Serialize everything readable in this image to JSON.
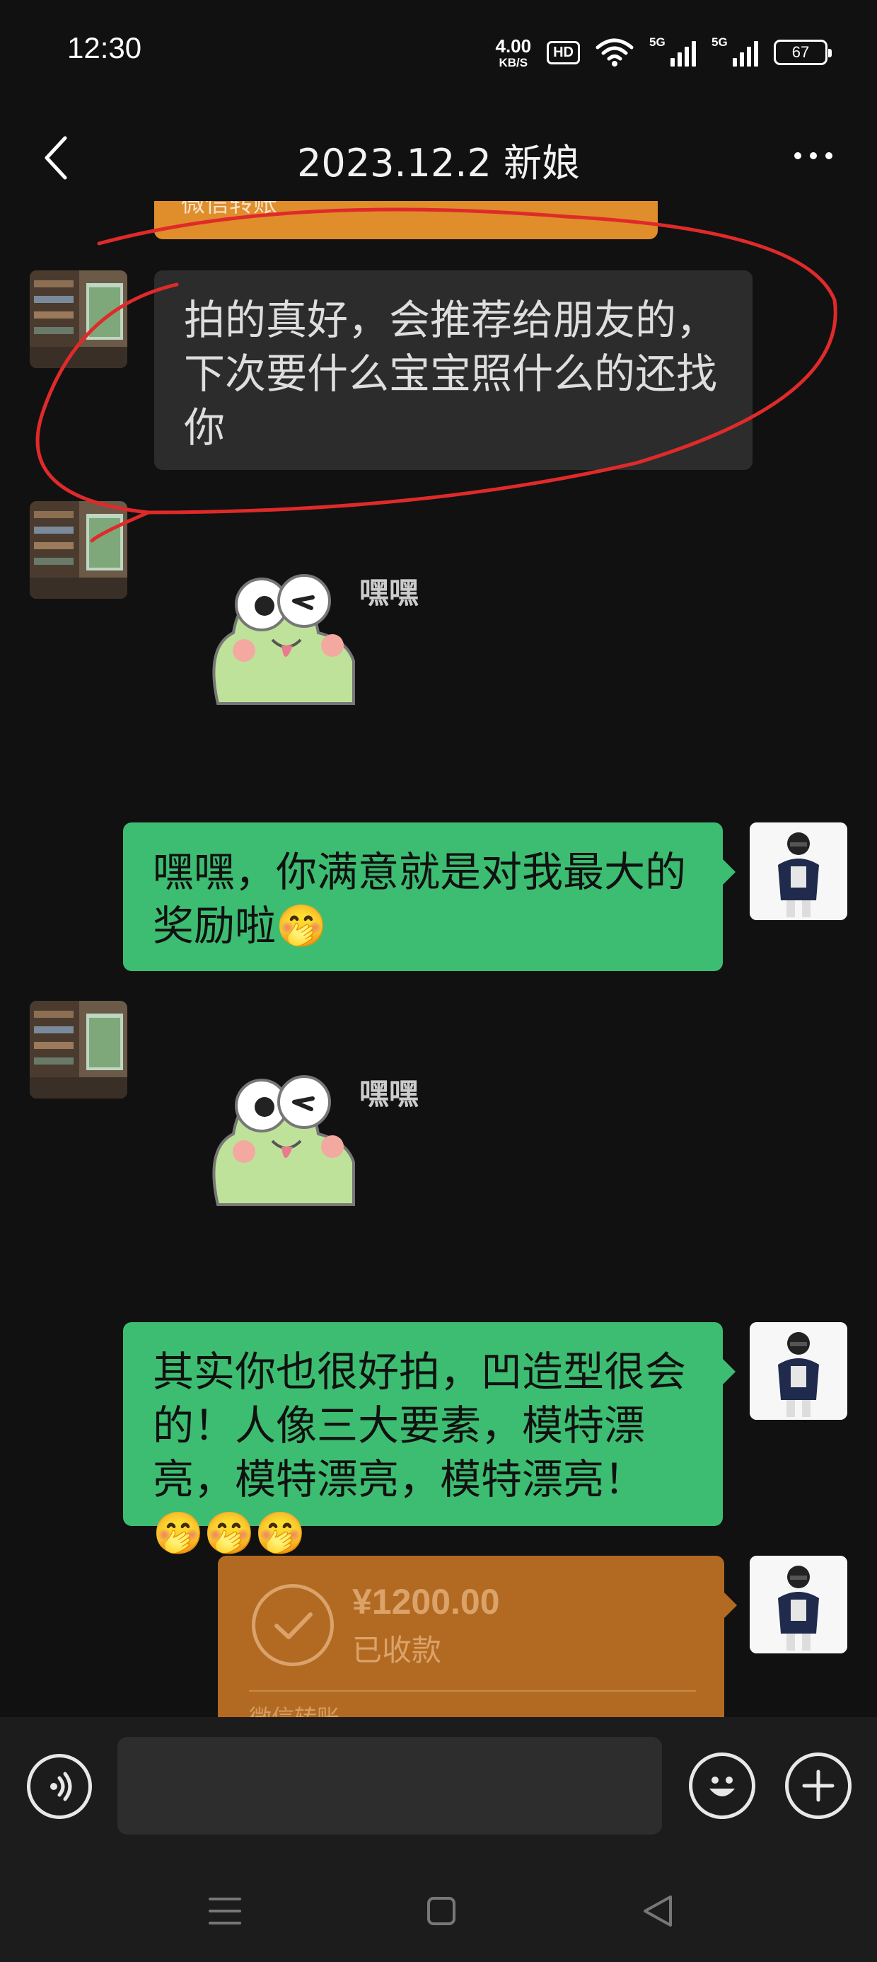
{
  "status_bar": {
    "time": "12:30",
    "net_speed_value": "4.00",
    "net_speed_unit": "KB/S",
    "hd_label": "HD",
    "signal1_label": "5G",
    "signal2_label": "5G",
    "battery_level": "67"
  },
  "header": {
    "title": "2023.12.2 新娘"
  },
  "messages": [
    {
      "side": "left",
      "type": "text",
      "text": "拍的真好，会推荐给朋友的，下次要什么宝宝照什么的还找你",
      "highlighted": true
    },
    {
      "side": "left",
      "type": "sticker",
      "sticker_text": "嘿嘿"
    },
    {
      "side": "right",
      "type": "text",
      "text": "嘿嘿，你满意就是对我最大的奖励啦🤭"
    },
    {
      "side": "left",
      "type": "sticker",
      "sticker_text": "嘿嘿"
    },
    {
      "side": "right",
      "type": "text",
      "text": "其实你也很好拍，凹造型很会的！人像三大要素，模特漂亮，模特漂亮，模特漂亮！🤭🤭🤭"
    },
    {
      "side": "right",
      "type": "transfer",
      "amount": "¥1200.00",
      "status": "已收款",
      "footer": "微信转账"
    }
  ],
  "peek_card_text": "微信转账",
  "input_bar": {
    "placeholder": ""
  },
  "colors": {
    "background": "#111111",
    "left_bubble": "#2c2c2c",
    "right_bubble": "#3dbd71",
    "transfer_card": "#b26a22",
    "highlight_ring": "#e02a2a"
  },
  "icons": {
    "back": "chevron-left-icon",
    "more": "more-horizontal-icon",
    "voice": "voice-icon",
    "emoji": "emoji-icon",
    "plus": "plus-icon",
    "nav_menu": "menu-icon",
    "nav_home": "square-icon",
    "nav_back": "triangle-back-icon"
  }
}
